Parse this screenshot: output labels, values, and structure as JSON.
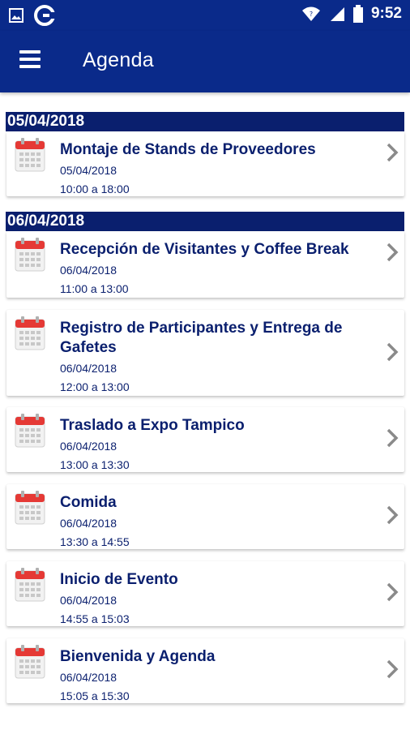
{
  "status_bar": {
    "time": "9:52",
    "icons": [
      "image-icon",
      "sync-app-icon",
      "wifi-icon",
      "signal-icon",
      "battery-icon"
    ]
  },
  "app_bar": {
    "title": "Agenda",
    "menu_icon": "hamburger-menu-icon"
  },
  "colors": {
    "primary": "#0a2a8a",
    "header_band": "#0a1f6e",
    "text": "#0a1f6e",
    "calendar_red": "#e53935",
    "chevron": "#8a8a8a"
  },
  "groups": [
    {
      "date": "05/04/2018",
      "events": [
        {
          "title": "Montaje de Stands de Proveedores",
          "date": "05/04/2018",
          "time": "10:00 a 18:00"
        }
      ]
    },
    {
      "date": "06/04/2018",
      "events": [
        {
          "title": "Recepción de Visitantes y Coffee Break",
          "date": "06/04/2018",
          "time": "11:00 a 13:00"
        },
        {
          "title": "Registro de Participantes y Entrega de Gafetes",
          "date": "06/04/2018",
          "time": "12:00 a 13:00"
        },
        {
          "title": "Traslado a Expo Tampico",
          "date": "06/04/2018",
          "time": "13:00 a 13:30"
        },
        {
          "title": "Comida",
          "date": "06/04/2018",
          "time": "13:30 a 14:55"
        },
        {
          "title": "Inicio de Evento",
          "date": "06/04/2018",
          "time": "14:55 a 15:03"
        },
        {
          "title": "Bienvenida y Agenda",
          "date": "06/04/2018",
          "time": "15:05 a 15:30"
        }
      ]
    }
  ]
}
